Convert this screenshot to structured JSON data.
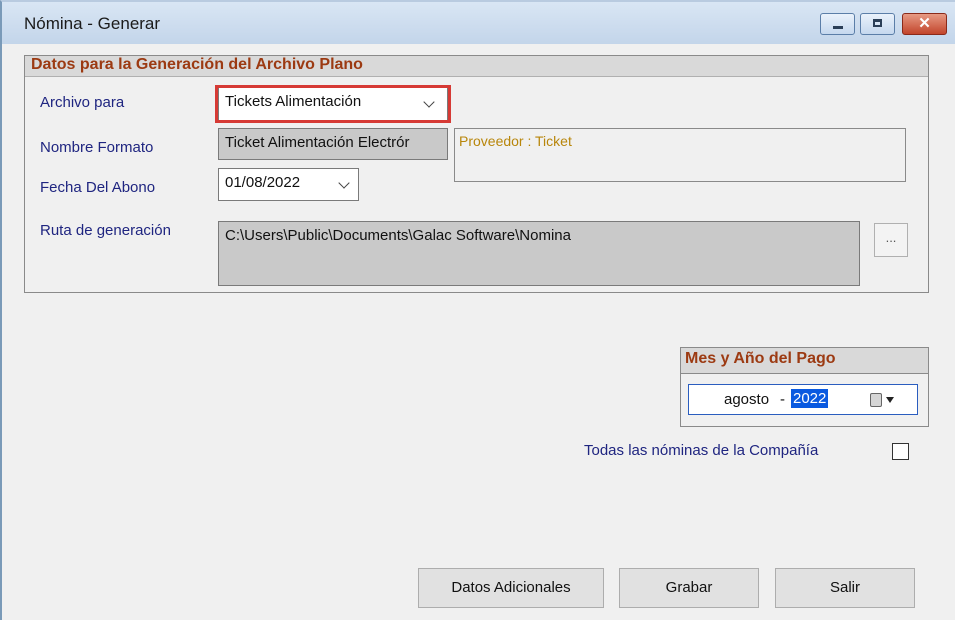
{
  "window": {
    "title": "Nómina - Generar",
    "controls": [
      "minimize-icon",
      "maximize-icon",
      "close-icon"
    ]
  },
  "group": {
    "title": "Datos para la Generación del Archivo Plano",
    "archivo_para": {
      "label": "Archivo para",
      "value": "Tickets Alimentación"
    },
    "nombre_formato": {
      "label": "Nombre Formato",
      "value": "Ticket Alimentación Electrór"
    },
    "proveedor": {
      "text": "Proveedor : Ticket"
    },
    "fecha_abono": {
      "label": "Fecha Del Abono",
      "value": "01/08/2022"
    },
    "ruta": {
      "label": "Ruta de generación",
      "value": "C:\\Users\\Public\\Documents\\Galac Software\\Nomina",
      "browse_label": "..."
    }
  },
  "mes_anio": {
    "title": "Mes y Año del Pago",
    "month": "agosto",
    "separator": "-",
    "year": "2022"
  },
  "todas_nominas": {
    "label": "Todas las nóminas de la Compañía",
    "checked": false
  },
  "buttons": {
    "datos_adicionales": "Datos Adicionales",
    "grabar": "Grabar",
    "salir": "Salir"
  },
  "colors": {
    "group_title": "#9c3a12",
    "label": "#1f2580",
    "highlight": "#d63a35",
    "proveedor_text": "#b8860b"
  }
}
